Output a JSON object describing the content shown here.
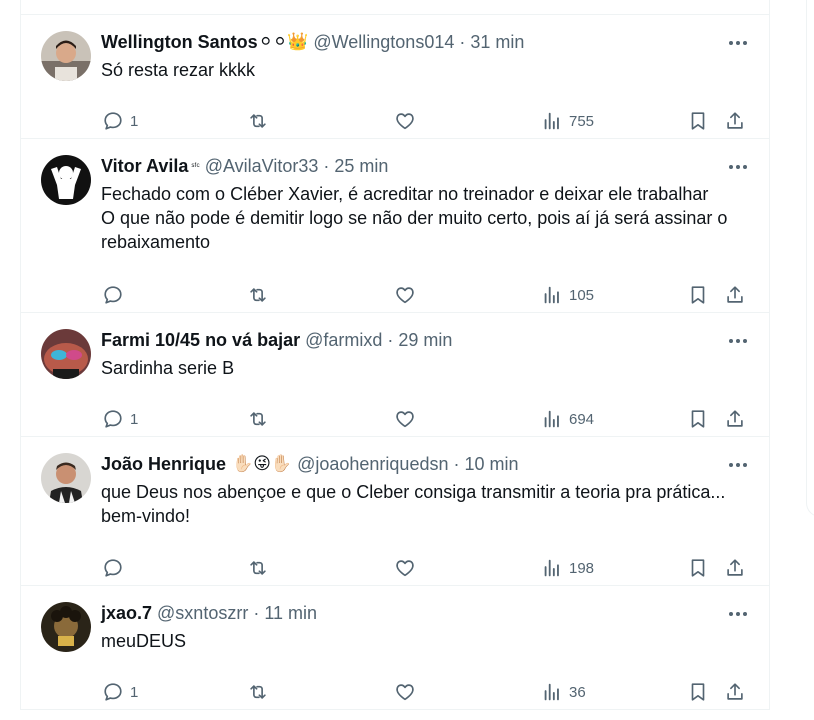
{
  "tweets": [
    {
      "name": "Wellington Santos",
      "name_emoji": "⚪⚪👑",
      "handle": "@Wellingtons014",
      "time": "31 min",
      "text": "Só resta rezar kkkk",
      "replies": "1",
      "views": "755"
    },
    {
      "name": "Vitor Avila",
      "name_emoji": "ˢᶠᶜ",
      "handle": "@AvilaVitor33",
      "time": "25 min",
      "text": "Fechado com o Cléber Xavier, é acreditar no treinador e deixar ele trabalhar\nO que não pode é demitir logo se não der muito certo, pois aí já será assinar o rebaixamento",
      "replies": "",
      "views": "105"
    },
    {
      "name": "Farmi 10/45 no vá bajar",
      "name_emoji": "",
      "handle": "@farmixd",
      "time": "29 min",
      "text": "Sardinha serie B",
      "replies": "1",
      "views": "694"
    },
    {
      "name": "João Henrique",
      "name_emoji": "✋🏻😜✋🏻",
      "handle": "@joaohenriquedsn",
      "time": "10 min",
      "text": "que Deus nos abençoe e que o Cleber consiga transmitir a teoria pra prática... bem-vindo!",
      "replies": "",
      "views": "198"
    },
    {
      "name": "jxao.7",
      "name_emoji": "",
      "handle": "@sxntoszrr",
      "time": "11 min",
      "text": "meuDEUS",
      "replies": "1",
      "views": "36"
    }
  ],
  "separator": "·",
  "colors": {
    "text": "#0f1419",
    "secondary": "#536471",
    "border": "#eff3f4"
  },
  "icons": [
    "reply-icon",
    "retweet-icon",
    "like-icon",
    "views-icon",
    "bookmark-icon",
    "share-icon",
    "more-icon"
  ]
}
